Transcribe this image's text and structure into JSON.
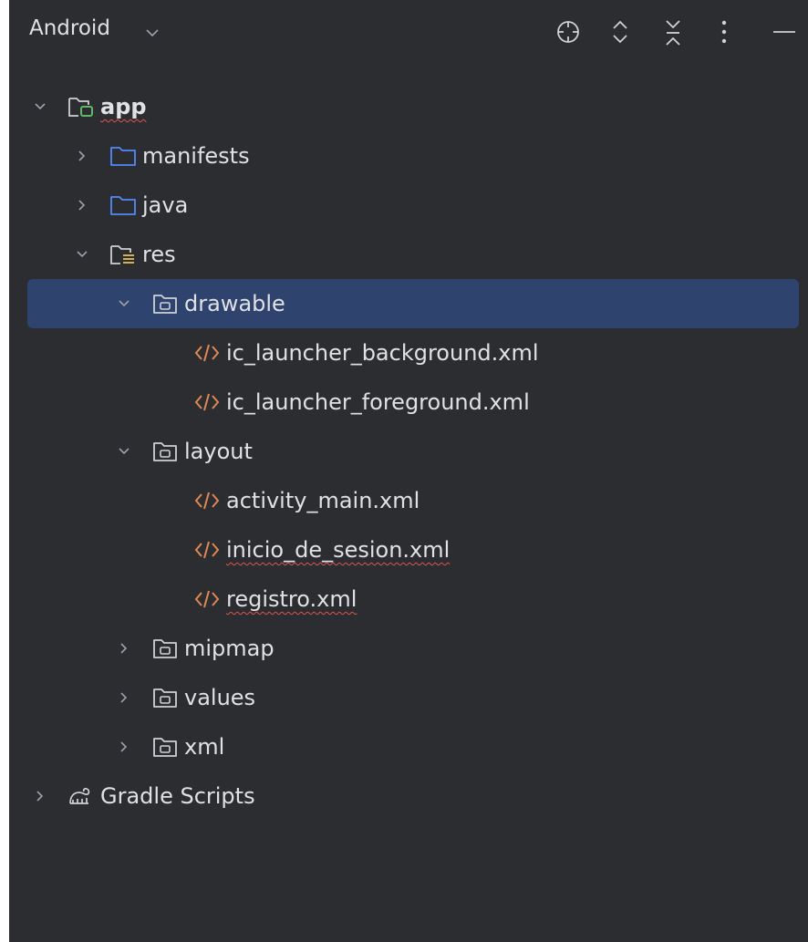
{
  "header": {
    "title": "Android",
    "icons": [
      "crosshair-icon",
      "expand-icon",
      "collapse-icon",
      "more-icon",
      "minimize-icon"
    ]
  },
  "tree": [
    {
      "label": "app",
      "indent": 0,
      "arrow": "down",
      "icon": "module-icon",
      "squiggle": true,
      "bold": true
    },
    {
      "label": "manifests",
      "indent": 1,
      "arrow": "right",
      "icon": "folder-icon"
    },
    {
      "label": "java",
      "indent": 1,
      "arrow": "right",
      "icon": "folder-icon"
    },
    {
      "label": "res",
      "indent": 1,
      "arrow": "down",
      "icon": "res-folder-icon"
    },
    {
      "label": "drawable",
      "indent": 2,
      "arrow": "down",
      "icon": "res-dir-icon",
      "selected": true
    },
    {
      "label": "ic_launcher_background.xml",
      "indent": 3,
      "arrow": "none",
      "icon": "xml-icon"
    },
    {
      "label": "ic_launcher_foreground.xml",
      "indent": 3,
      "arrow": "none",
      "icon": "xml-icon"
    },
    {
      "label": "layout",
      "indent": 2,
      "arrow": "down",
      "icon": "res-dir-icon"
    },
    {
      "label": "activity_main.xml",
      "indent": 3,
      "arrow": "none",
      "icon": "xml-icon"
    },
    {
      "label": "inicio_de_sesion.xml",
      "indent": 3,
      "arrow": "none",
      "icon": "xml-icon",
      "squiggle": true
    },
    {
      "label": "registro.xml",
      "indent": 3,
      "arrow": "none",
      "icon": "xml-icon",
      "squiggle": true
    },
    {
      "label": "mipmap",
      "indent": 2,
      "arrow": "right",
      "icon": "res-dir-icon"
    },
    {
      "label": "values",
      "indent": 2,
      "arrow": "right",
      "icon": "res-dir-icon"
    },
    {
      "label": "xml",
      "indent": 2,
      "arrow": "right",
      "icon": "res-dir-icon"
    },
    {
      "label": "Gradle Scripts",
      "indent": 0,
      "arrow": "right",
      "icon": "gradle-icon"
    }
  ],
  "colors": {
    "background": "#2b2d30",
    "selection": "#2e436e",
    "text": "#dfe1e5",
    "folder_blue": "#548af7",
    "module_green": "#5fb865",
    "xml_orange": "#e08855",
    "res_yellow": "#d6ae58",
    "error_squiggle": "#e0534b"
  }
}
